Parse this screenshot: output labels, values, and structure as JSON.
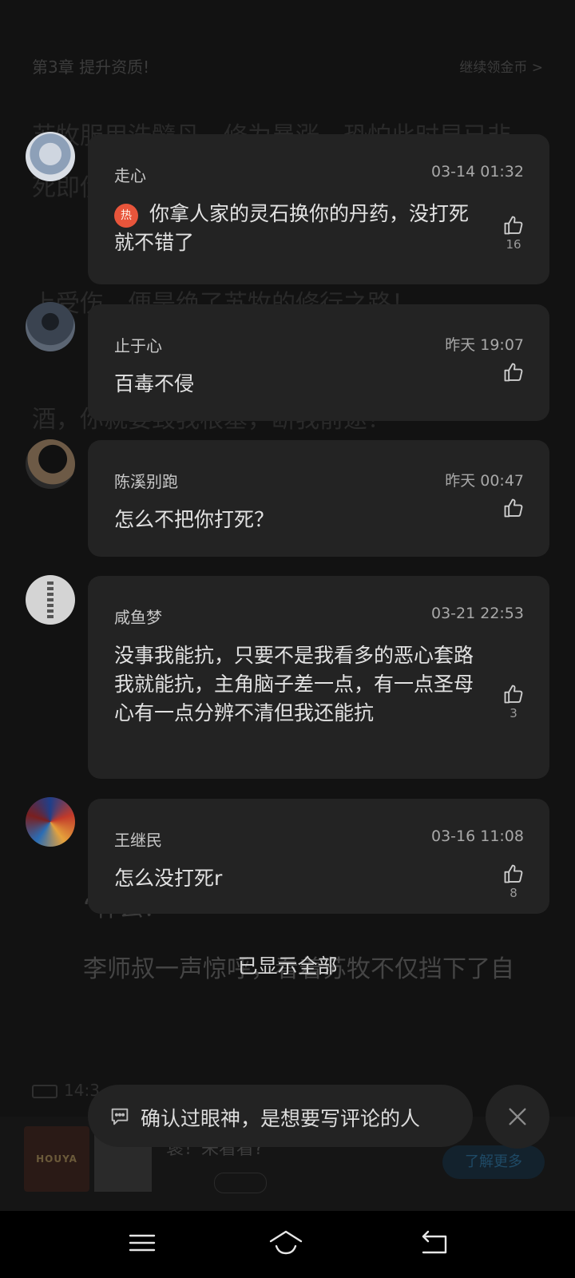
{
  "reader": {
    "chapter_title": "第3章 提升资质!",
    "coin_link": "继续领金币 >",
    "bg_lines": [
      "苏牧服用洗髓丹，修为暴涨，恐怕此时早已非",
      "死即伤",
      "上受伤，便是绝了苏牧的修行之路！",
      "酒，你就要毁我根基，断我前途？",
      "“什么？",
      "李师叔一声惊呼，看着苏牧不仅挡下了自"
    ],
    "status_time": "14:3"
  },
  "comments": [
    {
      "name": "走心",
      "time": "03-14 01:32",
      "badge": "热",
      "text": "你拿人家的灵石换你的丹药，没打死就不错了",
      "likes": "16"
    },
    {
      "name": "止于心",
      "time": "昨天 19:07",
      "text": "百毒不侵",
      "likes": ""
    },
    {
      "name": "陈溪别跑",
      "time": "昨天 00:47",
      "text": "怎么不把你打死？",
      "likes": ""
    },
    {
      "name": "咸鱼梦",
      "time": "03-21 22:53",
      "text": "没事我能抗，只要不是我看多的恶心套路我就能抗，主角脑子差一点，有一点圣母心有一点分辨不清但我还能抗",
      "likes": "3"
    },
    {
      "name": "王继民",
      "time": "03-16 11:08",
      "text": "怎么没打死r",
      "likes": "8"
    }
  ],
  "all_shown": "已显示全部",
  "comment_input": {
    "placeholder": "确认过眼神，是想要写评论的人"
  },
  "ad": {
    "logo_text": "HOUYA",
    "title": "褒！来看看?",
    "cta": "了解更多"
  },
  "icons": {
    "like": "thumbs-up-icon",
    "message": "message-icon",
    "close": "close-icon",
    "nav": [
      "menu-icon",
      "home-icon",
      "back-icon"
    ]
  },
  "colors": {
    "card_bg": "#232323",
    "hot_badge": "#e8553b",
    "overlay_bg": "#121212"
  }
}
